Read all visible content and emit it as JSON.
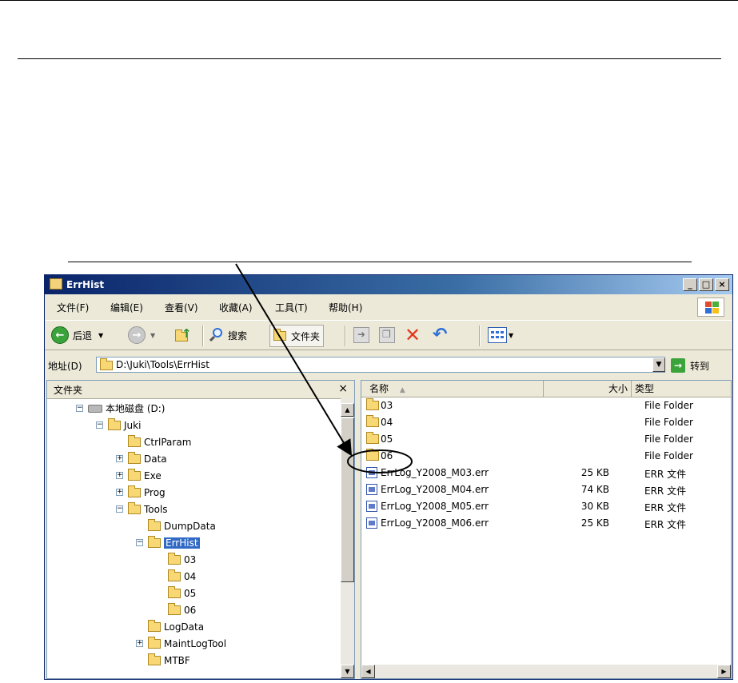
{
  "window": {
    "title": "ErrHist"
  },
  "menu": [
    "文件(F)",
    "编辑(E)",
    "查看(V)",
    "收藏(A)",
    "工具(T)",
    "帮助(H)"
  ],
  "toolbar": {
    "back": "后退",
    "search": "搜索",
    "folders": "文件夹"
  },
  "address": {
    "label": "地址(D)",
    "path": "D:\\Juki\\Tools\\ErrHist",
    "go": "转到"
  },
  "tree": {
    "header": "文件夹",
    "close": "×",
    "items": [
      {
        "label": "本地磁盘 (D:)",
        "exp": "−"
      },
      {
        "label": "Juki",
        "exp": "−"
      },
      {
        "label": "CtrlParam",
        "exp": ""
      },
      {
        "label": "Data",
        "exp": "+"
      },
      {
        "label": "Exe",
        "exp": "+"
      },
      {
        "label": "Prog",
        "exp": "+"
      },
      {
        "label": "Tools",
        "exp": "−"
      },
      {
        "label": "DumpData",
        "exp": ""
      },
      {
        "label": "ErrHist",
        "exp": "−"
      },
      {
        "label": "03",
        "exp": ""
      },
      {
        "label": "04",
        "exp": ""
      },
      {
        "label": "05",
        "exp": ""
      },
      {
        "label": "06",
        "exp": ""
      },
      {
        "label": "LogData",
        "exp": ""
      },
      {
        "label": "MaintLogTool",
        "exp": "+"
      },
      {
        "label": "MTBF",
        "exp": ""
      }
    ]
  },
  "list": {
    "columns": {
      "name": "名称",
      "size": "大小",
      "type": "类型"
    },
    "rows": [
      {
        "name": "03",
        "size": "",
        "type": "File Folder"
      },
      {
        "name": "04",
        "size": "",
        "type": "File Folder"
      },
      {
        "name": "05",
        "size": "",
        "type": "File Folder"
      },
      {
        "name": "06",
        "size": "",
        "type": "File Folder"
      },
      {
        "name": "ErrLog_Y2008_M03.err",
        "size": "25 KB",
        "type": "ERR 文件"
      },
      {
        "name": "ErrLog_Y2008_M04.err",
        "size": "74 KB",
        "type": "ERR 文件"
      },
      {
        "name": "ErrLog_Y2008_M05.err",
        "size": "30 KB",
        "type": "ERR 文件"
      },
      {
        "name": "ErrLog_Y2008_M06.err",
        "size": "25 KB",
        "type": "ERR 文件"
      }
    ]
  }
}
